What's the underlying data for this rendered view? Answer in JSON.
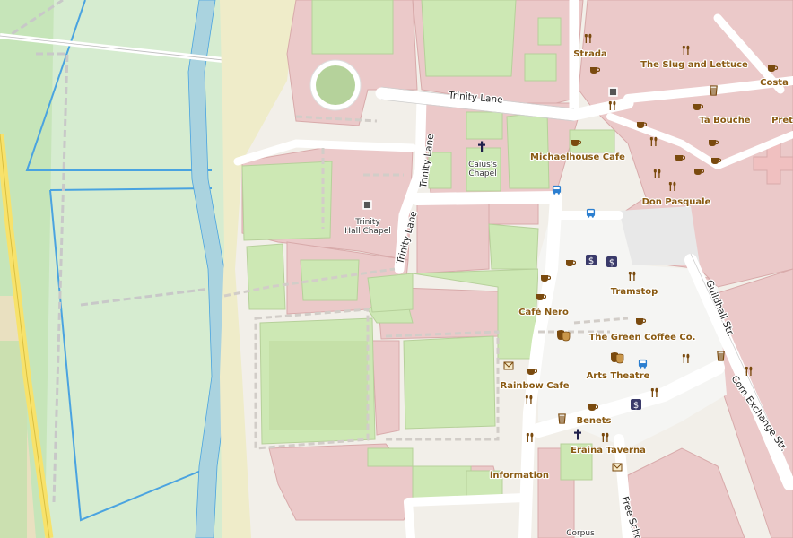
{
  "roads": {
    "trinity_lane_h": "Trinity Lane",
    "trinity_lane_v": "Trinity Lane",
    "guildhall": "Guildhall Str.",
    "corn_exchange": "Corn Exchange Str.",
    "free_school": "Free Scho"
  },
  "places": {
    "caius_line1": "Caius's",
    "caius_line2": "Chapel",
    "trinity_hall_line1": "Trinity",
    "trinity_hall_line2": "Hall Chapel",
    "strada": "Strada",
    "slug": "The Slug and Lettuce",
    "costa": "Costa",
    "ta_bouche": "Ta Bouche",
    "pret": "Pret",
    "michaelhouse": "Michaelhouse Cafe",
    "don_pasquale": "Don Pasquale",
    "tramstop": "Tramstop",
    "cafe_nero": "Café Nero",
    "green_coffee": "The Green Coffee Co.",
    "arts_theatre": "Arts Theatre",
    "rainbow": "Rainbow Cafe",
    "benets": "Benets",
    "eraina": "Eraina Taverna",
    "information": "information",
    "corpus": "Corpus"
  },
  "colors": {
    "background": "#f2efe9",
    "building_area": "#ebc9c9",
    "building_outline": "#d8aaaa",
    "grass": "#cde8b4",
    "meadow": "#d6ecd0",
    "lawn": "#b5d29b",
    "river": "#aad3df",
    "river_outline": "#4aa3e0",
    "pedestrian": "#ffffff",
    "plaza": "#f5f5f3",
    "parking": "#e8e8e8",
    "yellow_road": "#f7e26b",
    "poi": "#7a4a0e"
  }
}
